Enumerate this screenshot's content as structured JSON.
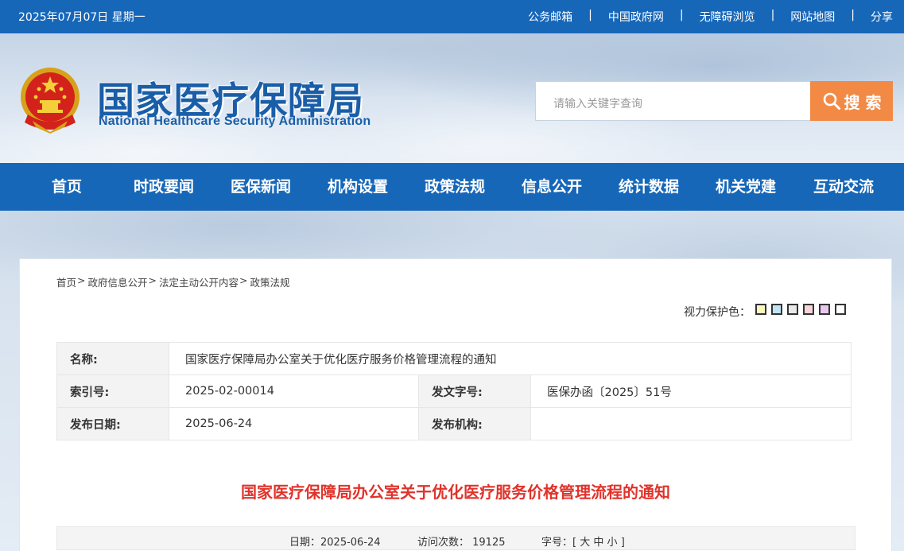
{
  "topbar": {
    "date": "2025年07月07日 星期一",
    "links": [
      "公务邮箱",
      "中国政府网",
      "无障碍浏览",
      "网站地图",
      "分享"
    ],
    "separator": "|"
  },
  "header": {
    "title_cn": "国家医疗保障局",
    "title_en": "National Healthcare Security Administration",
    "search_placeholder": "请输入关键字查询",
    "search_button": "搜 索"
  },
  "nav": {
    "items": [
      "首页",
      "时政要闻",
      "医保新闻",
      "机构设置",
      "政策法规",
      "信息公开",
      "统计数据",
      "机关党建",
      "互动交流"
    ]
  },
  "breadcrumb": [
    "首页",
    "政府信息公开",
    "法定主动公开内容",
    "政策法规"
  ],
  "breadcrumb_sep": ">",
  "eye_care": {
    "label": "视力保护色：",
    "colors": [
      "#fbf7c1",
      "#bfe4f5",
      "#e9e9e9",
      "#f6d4d9",
      "#e9c8f0",
      "#ffffff"
    ]
  },
  "meta": {
    "name_label": "名称:",
    "name_value": "国家医疗保障局办公室关于优化医疗服务价格管理流程的通知",
    "index_label": "索引号:",
    "index_value": "2025-02-00014",
    "docno_label": "发文字号:",
    "docno_value": "医保办函〔2025〕51号",
    "date_label": "发布日期:",
    "date_value": "2025-06-24",
    "org_label": "发布机构:",
    "org_value": ""
  },
  "article": {
    "title": "国家医疗保障局办公室关于优化医疗服务价格管理流程的通知",
    "date_text": "日期：2025-06-24",
    "visits_text": "访问次数： 19125",
    "font_label": "字号：",
    "font_open": "[",
    "font_sizes": [
      "大",
      "中",
      "小"
    ],
    "font_close": "]"
  }
}
